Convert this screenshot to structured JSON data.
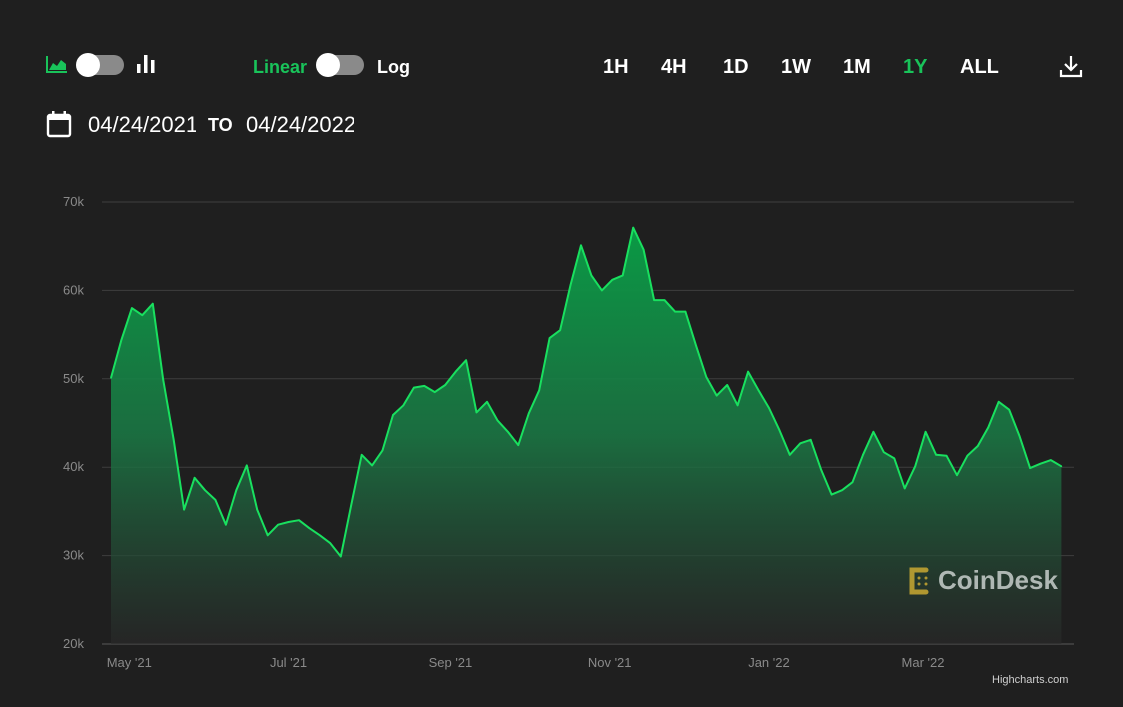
{
  "controls": {
    "chart_type_icons": [
      "area-chart-icon",
      "bar-chart-icon"
    ],
    "scale_linear": "Linear",
    "scale_log": "Log",
    "ranges": [
      "1H",
      "4H",
      "1D",
      "1W",
      "1M",
      "1Y",
      "ALL"
    ],
    "active_range": "1Y",
    "download_icon": "download-icon",
    "calendar_icon": "calendar-icon",
    "date_from": "04/24/2021",
    "date_to_label": "TO",
    "date_to": "04/24/2022",
    "accent": "#19c35a"
  },
  "watermark": {
    "logo_text": "CoinDesk"
  },
  "credits": "Highcharts.com",
  "chart_data": {
    "type": "area",
    "title": "",
    "xlabel": "",
    "ylabel": "",
    "ylim": [
      20000,
      70000
    ],
    "yticks": [
      20000,
      30000,
      40000,
      50000,
      60000,
      70000
    ],
    "ytick_labels": [
      "20k",
      "30k",
      "40k",
      "50k",
      "60k",
      "70k"
    ],
    "xticks": [
      "2021-05-01",
      "2021-07-01",
      "2021-09-01",
      "2021-11-01",
      "2022-01-01",
      "2022-03-01"
    ],
    "xtick_labels": [
      "May '21",
      "Jul '21",
      "Sep '21",
      "Nov '21",
      "Jan '22",
      "Mar '22"
    ],
    "xlim": [
      "2021-04-24",
      "2022-04-24"
    ],
    "grid": true,
    "line_color": "#19e05f",
    "x": [
      "2021-04-24",
      "2021-04-28",
      "2021-05-02",
      "2021-05-06",
      "2021-05-10",
      "2021-05-14",
      "2021-05-18",
      "2021-05-22",
      "2021-05-26",
      "2021-05-30",
      "2021-06-03",
      "2021-06-07",
      "2021-06-11",
      "2021-06-15",
      "2021-06-19",
      "2021-06-23",
      "2021-06-27",
      "2021-07-01",
      "2021-07-05",
      "2021-07-09",
      "2021-07-13",
      "2021-07-17",
      "2021-07-21",
      "2021-07-25",
      "2021-07-29",
      "2021-08-02",
      "2021-08-06",
      "2021-08-10",
      "2021-08-14",
      "2021-08-18",
      "2021-08-22",
      "2021-08-26",
      "2021-08-30",
      "2021-09-03",
      "2021-09-07",
      "2021-09-11",
      "2021-09-15",
      "2021-09-19",
      "2021-09-23",
      "2021-09-27",
      "2021-10-01",
      "2021-10-05",
      "2021-10-09",
      "2021-10-13",
      "2021-10-17",
      "2021-10-21",
      "2021-10-25",
      "2021-10-29",
      "2021-11-02",
      "2021-11-06",
      "2021-11-10",
      "2021-11-14",
      "2021-11-18",
      "2021-11-22",
      "2021-11-26",
      "2021-11-30",
      "2021-12-04",
      "2021-12-08",
      "2021-12-12",
      "2021-12-16",
      "2021-12-20",
      "2021-12-24",
      "2021-12-28",
      "2022-01-01",
      "2022-01-05",
      "2022-01-09",
      "2022-01-13",
      "2022-01-17",
      "2022-01-21",
      "2022-01-25",
      "2022-01-29",
      "2022-02-02",
      "2022-02-06",
      "2022-02-10",
      "2022-02-14",
      "2022-02-18",
      "2022-02-22",
      "2022-02-26",
      "2022-03-02",
      "2022-03-06",
      "2022-03-10",
      "2022-03-14",
      "2022-03-18",
      "2022-03-22",
      "2022-03-26",
      "2022-03-30",
      "2022-04-03",
      "2022-04-07",
      "2022-04-11",
      "2022-04-15",
      "2022-04-19",
      "2022-04-23"
    ],
    "values": [
      50100,
      54400,
      58000,
      57200,
      58500,
      49900,
      43100,
      35200,
      38800,
      37400,
      36300,
      33500,
      37400,
      40200,
      35200,
      32300,
      33500,
      33800,
      34000,
      33100,
      32300,
      31400,
      29900,
      35700,
      41400,
      40200,
      41900,
      45900,
      47000,
      49000,
      49200,
      48500,
      49300,
      50800,
      52100,
      46200,
      47400,
      45300,
      44000,
      42500,
      46100,
      48700,
      54600,
      55500,
      60600,
      65100,
      61700,
      60000,
      61200,
      61700,
      67100,
      64600,
      58900,
      58900,
      57600,
      57600,
      53800,
      50200,
      48100,
      49300,
      47000,
      50800,
      48700,
      46700,
      44200,
      41400,
      42700,
      43100,
      39700,
      36900,
      37400,
      38300,
      41400,
      44000,
      41700,
      41000,
      37600,
      40100,
      44000,
      41400,
      41300,
      39100,
      41300,
      42400,
      44500,
      47400,
      46500,
      43500,
      39900,
      40400,
      40800,
      40100
    ]
  }
}
